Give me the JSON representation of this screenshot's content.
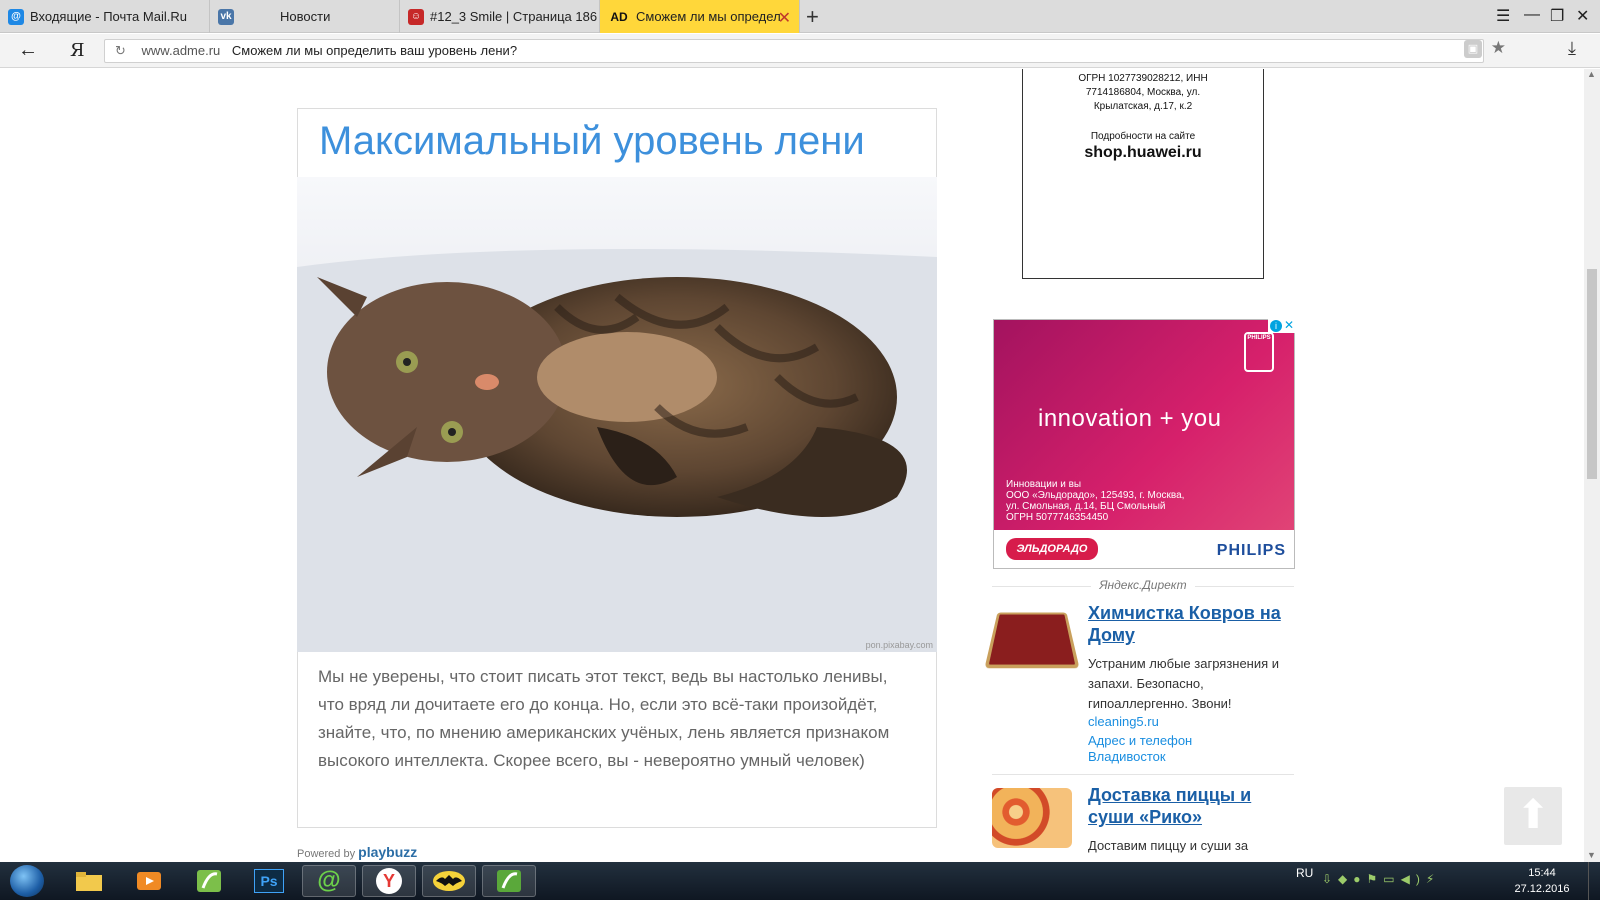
{
  "tabs": [
    {
      "label": "Входящие - Почта Mail.Ru",
      "icon": "mailru-icon"
    },
    {
      "label": "Новости",
      "icon": "vk-icon"
    },
    {
      "label": "#12_3 Smile | Страница 186",
      "icon": "smile-icon"
    },
    {
      "label": "Сможем ли мы определ",
      "icon": "ad-icon",
      "badge": "AD",
      "active": true
    }
  ],
  "new_tab": "+",
  "address_bar": {
    "domain": "www.adme.ru",
    "title": "Сможем ли мы определить ваш уровень лени?",
    "ya": "Я"
  },
  "article": {
    "headline": "Максимальный уровень лени",
    "photo_credit": "pon.pixabay.com",
    "body": "Мы не уверены, что стоит писать этот текст, ведь вы настолько ленивы, что вряд ли дочитаете его до конца. Но, если это всё-таки произойдёт, знайте, что, по мнению американских учёных, лень является признаком высокого интеллекта. Скорее всего, вы - невероятно умный человек)",
    "powered_by": "Powered by",
    "powered_brand": "playbuzz"
  },
  "huawei_ad": {
    "line1": "ОГРН 1027739028212, ИНН",
    "line2": "7714186804, Москва, ул.",
    "line3": "Крылатская, д.17, к.2",
    "more": "Подробности на сайте",
    "site": "shop.huawei.ru"
  },
  "philips_ad": {
    "logo_text": "PHILIPS",
    "tagline": "innovation + you",
    "legal1": "Инновации и вы",
    "legal2": "ООО «Эльдорадо», 125493, г. Москва,",
    "legal3": "ул. Смольная, д.14, БЦ Смольный",
    "legal4": "ОГРН 5077746354450",
    "eldorado": "ЭЛЬДОРАДО",
    "brand": "PHILIPS",
    "info": "i",
    "close": "✕"
  },
  "direct": {
    "label": "Яндекс.Директ",
    "ads": [
      {
        "title": "Химчистка Ковров на Дому",
        "desc": "Устраним любые загрязнения и запахи. Безопасно, гипоаллергенно. Звони!",
        "link1": "cleaning5.ru",
        "link2": "Адрес и телефон",
        "link3": "Владивосток"
      },
      {
        "title": "Доставка пиццы и суши «Рико»",
        "desc": "Доставим пиццу и суши за"
      }
    ]
  },
  "taskbar": {
    "lang": "RU",
    "time": "15:44",
    "date": "27.12.2016",
    "apps": [
      "explorer-icon",
      "media-player-icon",
      "app-green-icon",
      "photoshop-icon",
      "mail-agent-icon",
      "yandex-browser-icon",
      "batman-icon",
      "app-green2-icon"
    ],
    "ps_label": "Ps"
  },
  "colors": {
    "active_tab": "#ffd73a",
    "headline": "#3d90dc",
    "link": "#1a5fa6",
    "ad_pink": "#c2185b"
  }
}
